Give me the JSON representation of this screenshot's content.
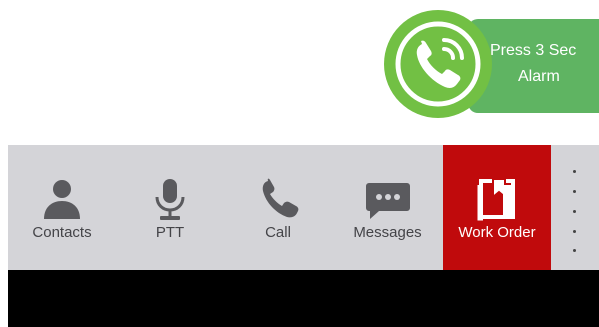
{
  "alarm": {
    "line1": "Press 3 Sec",
    "line2": "Alarm",
    "icon": "phone-handset-icon",
    "colors": {
      "circle": "#72c044",
      "pill": "#5fb462"
    }
  },
  "toolbar": {
    "items": [
      {
        "label": "Contacts",
        "icon": "person-icon"
      },
      {
        "label": "PTT",
        "icon": "microphone-icon"
      },
      {
        "label": "Call",
        "icon": "phone-icon"
      },
      {
        "label": "Messages",
        "icon": "chat-bubble-icon"
      },
      {
        "label": "Work Order",
        "icon": "bookmark-book-icon",
        "active": true
      }
    ],
    "overflow_icon": "vertical-dots-icon",
    "colors": {
      "bar": "#d4d4d8",
      "active": "#c00a0c",
      "icon": "#5a5a5e"
    }
  }
}
